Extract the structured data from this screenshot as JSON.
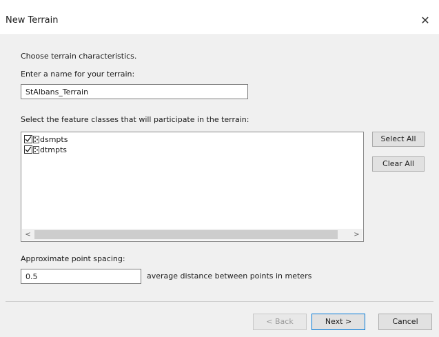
{
  "window": {
    "title": "New Terrain",
    "close_glyph": "✕"
  },
  "intro": {
    "heading": "Choose terrain characteristics.",
    "name_label": "Enter a name for your terrain:",
    "name_value": "StAlbans_Terrain"
  },
  "features": {
    "label": "Select the feature classes that will participate in the terrain:",
    "items": [
      {
        "label": "dsmpts",
        "checked": true,
        "icon": "point-feature-class-icon"
      },
      {
        "label": "dtmpts",
        "checked": true,
        "icon": "point-feature-class-icon"
      }
    ],
    "select_all": "Select All",
    "clear_all": "Clear All",
    "scroll_left": "<",
    "scroll_right": ">"
  },
  "spacing": {
    "label": "Approximate point spacing:",
    "value": "0.5",
    "hint": "average distance between points in meters"
  },
  "footer": {
    "back": "< Back",
    "next": "Next >",
    "cancel": "Cancel"
  }
}
